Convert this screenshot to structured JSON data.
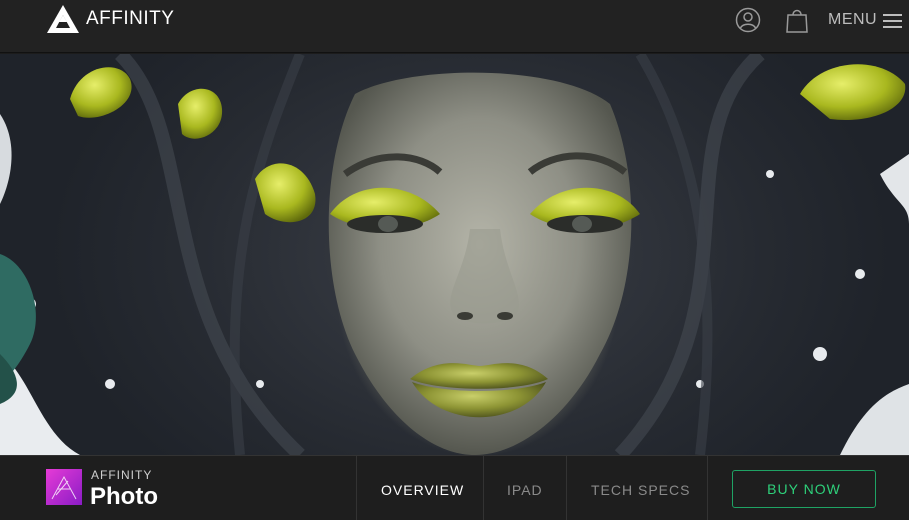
{
  "header": {
    "brand_name": "AFFINITY",
    "menu_label": "MENU",
    "icons": [
      "affinity-logo-icon",
      "account-icon",
      "cart-icon",
      "hamburger-icon"
    ]
  },
  "hero": {
    "accent_color": "#b9c727"
  },
  "product_bar": {
    "brand_small": "AFFINITY",
    "product_name": "Photo",
    "nav": {
      "overview": "OVERVIEW",
      "ipad": "IPAD",
      "tech_specs": "TECH SPECS"
    },
    "buy_label": "BUY NOW",
    "buy_color": "#2ed07a"
  }
}
